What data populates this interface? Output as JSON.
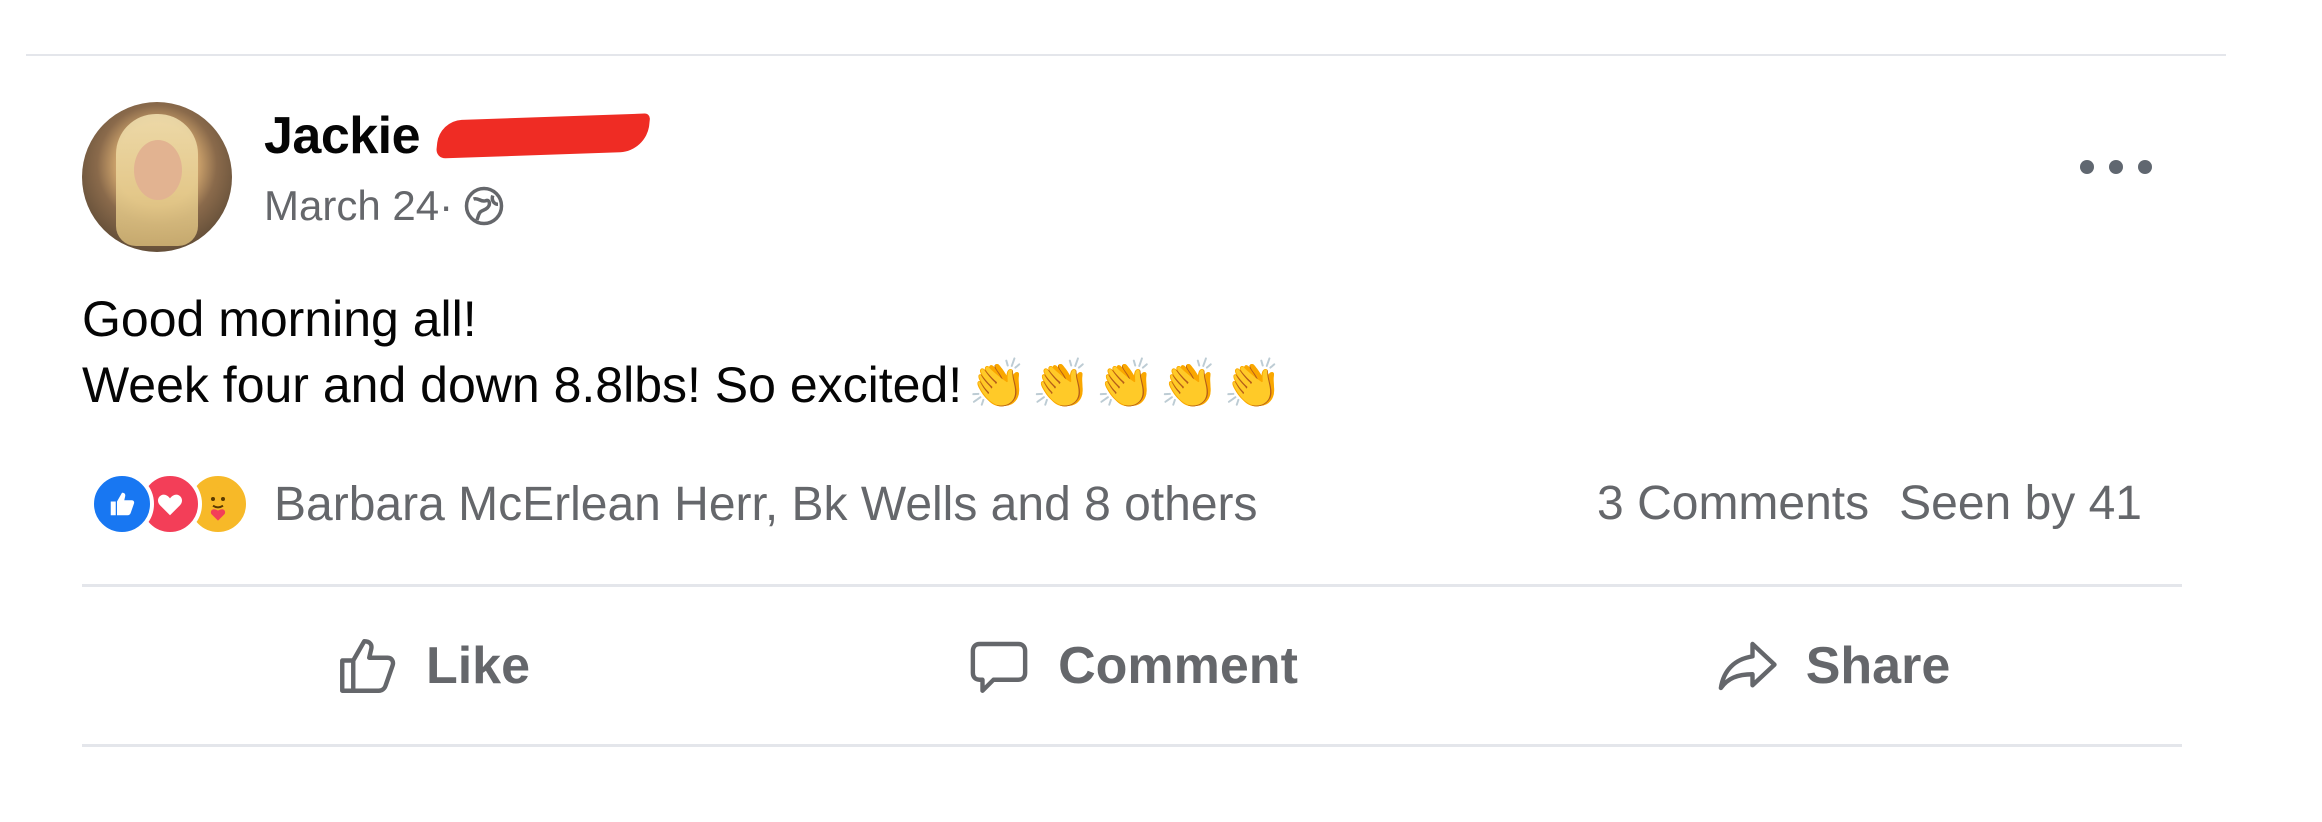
{
  "post": {
    "author": "Jackie",
    "date": "March 24",
    "separator": " · ",
    "lines": [
      "Good morning all!",
      "Week four and down 8.8lbs! So excited!"
    ],
    "emoji": "👏👏👏👏👏"
  },
  "reactions": {
    "icons": [
      "like-icon",
      "love-icon",
      "care-icon"
    ],
    "names": "Barbara McErlean Herr, Bk Wells and 8 others",
    "comments": "3 Comments",
    "seen": "Seen by 41"
  },
  "actions": {
    "like": "Like",
    "comment": "Comment",
    "share": "Share"
  },
  "colors": {
    "like": "#1877f2",
    "love": "#f33e58",
    "care": "#f7b928",
    "redaction": "#ef2c24"
  }
}
